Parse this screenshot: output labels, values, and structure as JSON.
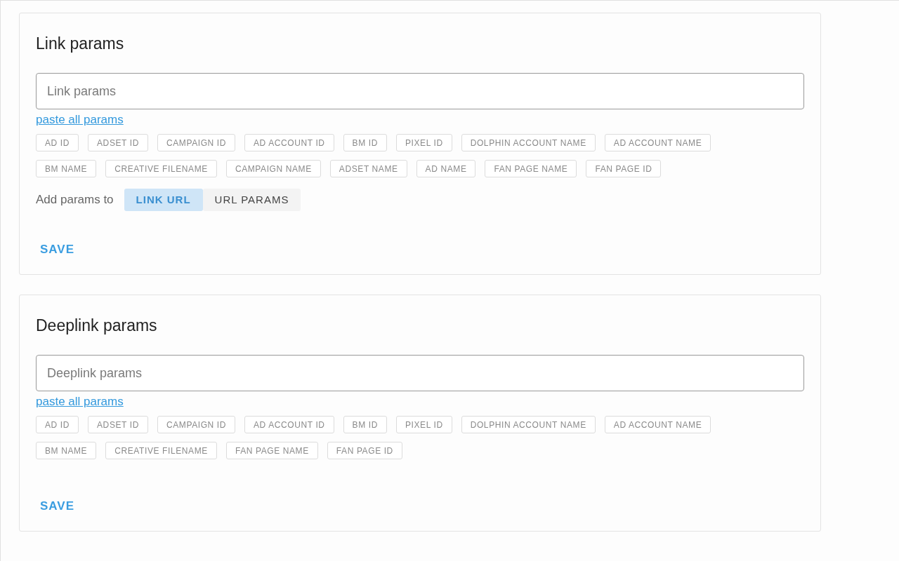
{
  "sections": [
    {
      "title": "Link params",
      "placeholder": "Link params",
      "link": "paste all params",
      "chips": [
        "AD ID",
        "ADSET ID",
        "CAMPAIGN ID",
        "AD ACCOUNT ID",
        "BM ID",
        "PIXEL ID",
        "DOLPHIN ACCOUNT NAME",
        "AD ACCOUNT NAME",
        "BM NAME",
        "CREATIVE FILENAME",
        "CAMPAIGN NAME",
        "ADSET NAME",
        "AD NAME",
        "FAN PAGE NAME",
        "FAN PAGE ID"
      ],
      "target": {
        "label": "Add params to",
        "options": [
          {
            "label": "LINK URL",
            "selected": true
          },
          {
            "label": "URL PARAMS",
            "selected": false
          }
        ]
      },
      "save": "SAVE"
    },
    {
      "title": "Deeplink params",
      "placeholder": "Deeplink params",
      "link": "paste all params",
      "chips": [
        "AD ID",
        "ADSET ID",
        "CAMPAIGN ID",
        "AD ACCOUNT ID",
        "BM ID",
        "PIXEL ID",
        "DOLPHIN ACCOUNT NAME",
        "AD ACCOUNT NAME",
        "BM NAME",
        "CREATIVE FILENAME",
        "FAN PAGE NAME",
        "FAN PAGE ID"
      ],
      "save": "SAVE"
    }
  ]
}
